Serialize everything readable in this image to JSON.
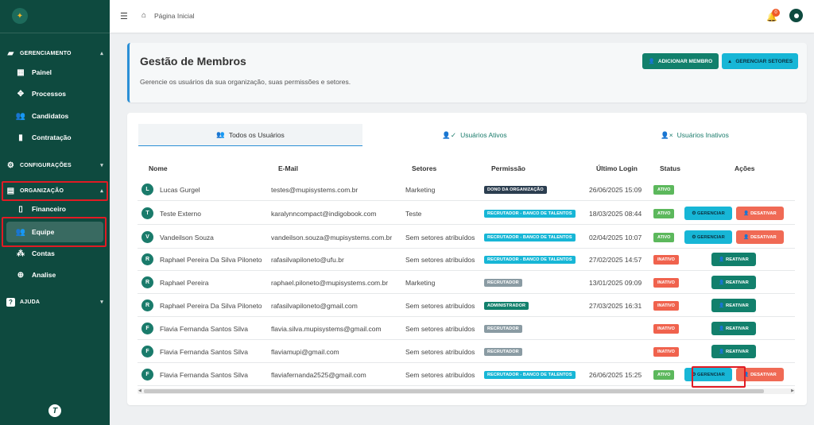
{
  "sidebar": {
    "sections": [
      {
        "label": "GERENCIAMENTO",
        "icon": "briefcase-icon",
        "chev": "▴"
      },
      {
        "label": "CONFIGURAÇÕES",
        "icon": "gear-icon",
        "chev": "▾"
      },
      {
        "label": "ORGANIZAÇÃO",
        "icon": "building-icon",
        "chev": "▴"
      },
      {
        "label": "AJUDA",
        "icon": "help-icon",
        "chev": "▾"
      }
    ],
    "items": [
      {
        "label": "Painel",
        "icon": "dashboard-icon"
      },
      {
        "label": "Processos",
        "icon": "process-icon"
      },
      {
        "label": "Candidatos",
        "icon": "people-icon"
      },
      {
        "label": "Contratação",
        "icon": "contract-icon"
      },
      {
        "label": "Financeiro",
        "icon": "finance-icon"
      },
      {
        "label": "Equipe",
        "icon": "team-icon"
      },
      {
        "label": "Contas",
        "icon": "accounts-icon"
      },
      {
        "label": "Analise",
        "icon": "analysis-icon"
      }
    ]
  },
  "topbar": {
    "breadcrumb": "Página Inicial",
    "notification_count": "0"
  },
  "header": {
    "title": "Gestão de Membros",
    "description": "Gerencie os usuários da sua organização, suas permissões e setores.",
    "add_member": "ADICIONAR MEMBRO",
    "manage_sectors": "GERENCIAR SETORES"
  },
  "tabs": [
    {
      "label": "Todos os Usuários"
    },
    {
      "label": "Usuários Ativos"
    },
    {
      "label": "Usuários Inativos"
    }
  ],
  "table": {
    "headers": [
      "Nome",
      "E-Mail",
      "Setores",
      "Permissão",
      "Último Login",
      "Status",
      "Ações"
    ],
    "rows": [
      {
        "initial": "L",
        "name": "Lucas Gurgel",
        "email": "testes@mupisystems.com.br",
        "sector": "Marketing",
        "permission": "DONO DA ORGANIZAÇÃO",
        "perm_color": "#2c3e50",
        "last_login": "26/06/2025 15:09",
        "status": "ATIVO",
        "status_color": "#5cb85c",
        "actions": []
      },
      {
        "initial": "T",
        "name": "Teste Externo",
        "email": "karalynncompact@indigobook.com",
        "sector": "Teste",
        "permission": "RECRUTADOR - BANCO DE TALENTOS",
        "perm_color": "#17b6d6",
        "last_login": "18/03/2025 08:44",
        "status": "ATIVO",
        "status_color": "#5cb85c",
        "actions": [
          "manage",
          "deactivate"
        ]
      },
      {
        "initial": "V",
        "name": "Vandeilson Souza",
        "email": "vandeilson.souza@mupisystems.com.br",
        "sector": "Sem setores atribuídos",
        "permission": "RECRUTADOR - BANCO DE TALENTOS",
        "perm_color": "#17b6d6",
        "last_login": "02/04/2025 10:07",
        "status": "ATIVO",
        "status_color": "#5cb85c",
        "actions": [
          "manage",
          "deactivate"
        ]
      },
      {
        "initial": "R",
        "name": "Raphael Pereira Da Silva Piloneto",
        "email": "rafasilvapiloneto@ufu.br",
        "sector": "Sem setores atribuídos",
        "permission": "RECRUTADOR - BANCO DE TALENTOS",
        "perm_color": "#17b6d6",
        "last_login": "27/02/2025 14:57",
        "status": "INATIVO",
        "status_color": "#f0624d",
        "actions": [
          "reactivate"
        ]
      },
      {
        "initial": "R",
        "name": "Raphael Pereira",
        "email": "raphael.piloneto@mupisystems.com.br",
        "sector": "Marketing",
        "permission": "RECRUTADOR",
        "perm_color": "#8a9ba3",
        "last_login": "13/01/2025 09:09",
        "status": "INATIVO",
        "status_color": "#f0624d",
        "actions": [
          "reactivate"
        ]
      },
      {
        "initial": "R",
        "name": "Raphael Pereira Da Silva Piloneto",
        "email": "rafasilvapiloneto@gmail.com",
        "sector": "Sem setores atribuídos",
        "permission": "ADMINISTRADOR",
        "perm_color": "#12806c",
        "last_login": "27/03/2025 16:31",
        "status": "INATIVO",
        "status_color": "#f0624d",
        "actions": [
          "reactivate"
        ]
      },
      {
        "initial": "F",
        "name": "Flavia Fernanda Santos Silva",
        "email": "flavia.silva.mupisystems@gmail.com",
        "sector": "Sem setores atribuídos",
        "permission": "RECRUTADOR",
        "perm_color": "#8a9ba3",
        "last_login": "",
        "status": "INATIVO",
        "status_color": "#f0624d",
        "actions": [
          "reactivate"
        ]
      },
      {
        "initial": "F",
        "name": "Flavia Fernanda Santos Silva",
        "email": "flaviamupi@gmail.com",
        "sector": "Sem setores atribuídos",
        "permission": "RECRUTADOR",
        "perm_color": "#8a9ba3",
        "last_login": "",
        "status": "INATIVO",
        "status_color": "#f0624d",
        "actions": [
          "reactivate"
        ]
      },
      {
        "initial": "F",
        "name": "Flavia Fernanda Santos Silva",
        "email": "flaviafernanda2525@gmail.com",
        "sector": "Sem setores atribuídos",
        "permission": "RECRUTADOR - BANCO DE TALENTOS",
        "perm_color": "#17b6d6",
        "last_login": "26/06/2025 15:25",
        "status": "ATIVO",
        "status_color": "#5cb85c",
        "actions": [
          "manage",
          "deactivate"
        ]
      }
    ],
    "action_labels": {
      "manage": "⚙ GERENCIAR",
      "deactivate": "👤 DESATIVAR",
      "reactivate": "👤 REATIVAR"
    }
  }
}
